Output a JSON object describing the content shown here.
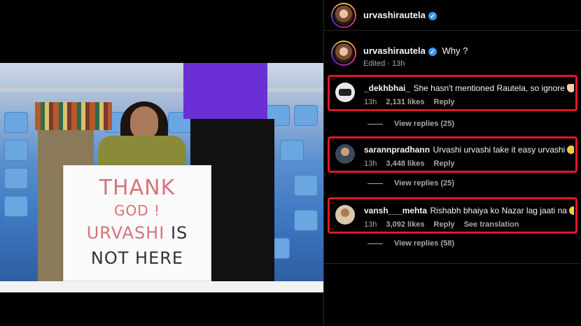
{
  "header": {
    "username": "urvashirautela"
  },
  "caption": {
    "username": "urvashirautela",
    "text": "Why ?",
    "meta": "Edited · 13h"
  },
  "sign": {
    "line1": "THANK",
    "line2": "GOD !",
    "line3a": "URVASHI",
    "line3b": "IS",
    "line4": "NOT HERE"
  },
  "comments": [
    {
      "username": "_dekhbhai_",
      "text": "She hasn't mentioned Rautela, so ignore",
      "emoji": "victory-hand",
      "time": "13h",
      "likes": "2,131 likes",
      "reply": "Reply",
      "translate": "",
      "view_replies": "View replies (25)",
      "avatar_color": "#e9e9e9"
    },
    {
      "username": "sarannpradhann",
      "text": "Urvashi urvashi take it easy urvashi",
      "emoji": "heart-eyes",
      "time": "13h",
      "likes": "3,448 likes",
      "reply": "Reply",
      "translate": "",
      "view_replies": "View replies (25)",
      "avatar_color": "#3a4a5a"
    },
    {
      "username": "vansh___mehta",
      "text": "Rishabh bhaiya ko Nazar lag jaati na",
      "emoji": "heart-eyes",
      "time": "13h",
      "likes": "3,092 likes",
      "reply": "Reply",
      "translate": "See translation",
      "view_replies": "View replies (58)",
      "avatar_color": "#d8c9a8"
    }
  ],
  "colors": {
    "highlight": "#e0162b",
    "verified": "#3897f0",
    "muted": "#a8a8a8"
  }
}
